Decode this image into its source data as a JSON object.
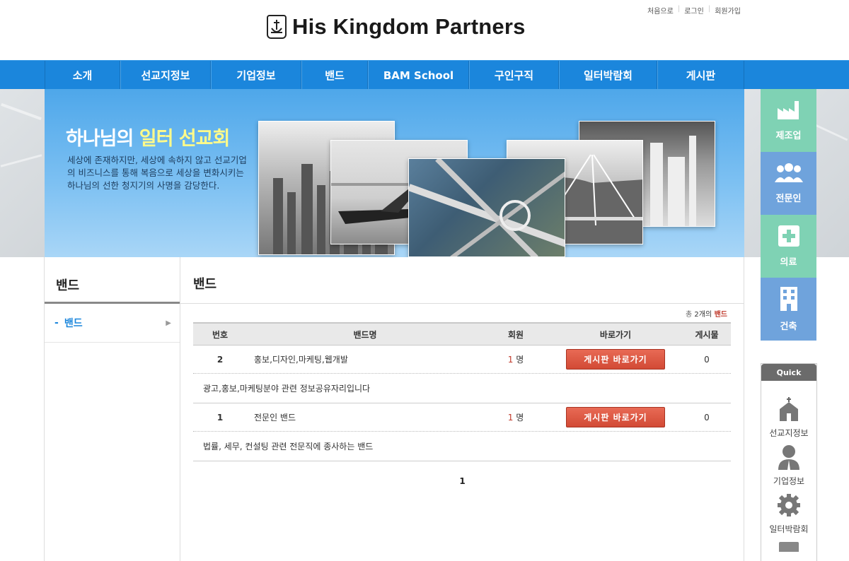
{
  "header": {
    "logo_text": "His Kingdom Partners",
    "util_links": [
      "처음으로",
      "로그인",
      "회원가입"
    ]
  },
  "nav": {
    "items": [
      "소개",
      "선교지정보",
      "기업정보",
      "밴드",
      "BAM School",
      "구인구직",
      "일터박람회",
      "게시판"
    ]
  },
  "banner": {
    "title_prefix": "하나님의 ",
    "title_highlight": "일터 선교회",
    "description": "세상에 존재하지만, 세상에 속하지 않고 선교기업의 비즈니스를 통해 복음으로 세상을 변화시키는 하나님의 선한 청지기의 사명을 감당한다."
  },
  "side_menu": [
    {
      "label": "제조업",
      "icon": "factory-icon",
      "color": "#7fd2b4"
    },
    {
      "label": "전문인",
      "icon": "people-icon",
      "color": "#6fa3dc"
    },
    {
      "label": "의료",
      "icon": "medical-cross-icon",
      "color": "#7fd2b4"
    },
    {
      "label": "건축",
      "icon": "building-icon",
      "color": "#6fa3dc"
    }
  ],
  "quick": {
    "title": "Quick",
    "items": [
      {
        "label": "선교지정보",
        "icon": "church-icon"
      },
      {
        "label": "기업정보",
        "icon": "person-icon"
      },
      {
        "label": "일터박람회",
        "icon": "gear-icon"
      }
    ]
  },
  "lnb": {
    "title": "밴드",
    "items": [
      {
        "label": "밴드"
      }
    ]
  },
  "content": {
    "title": "밴드",
    "total_prefix": "총 ",
    "total_count": "2개의",
    "total_suffix": " 밴드",
    "columns": [
      "번호",
      "밴드명",
      "회원",
      "바로가기",
      "게시물"
    ],
    "rows": [
      {
        "no": "2",
        "name": "홍보,디자인,마케팅,웹개발",
        "members": "1",
        "members_unit": " 명",
        "button": "게시판 바로가기",
        "posts": "0",
        "description": "광고,홍보,마케팅분야 관련 정보공유자리입니다"
      },
      {
        "no": "1",
        "name": "전문인 밴드",
        "members": "1",
        "members_unit": " 명",
        "button": "게시판 바로가기",
        "posts": "0",
        "description": "법률, 세무, 컨설팅 관련 전문직에 종사하는 밴드"
      }
    ],
    "pagination": "1"
  }
}
